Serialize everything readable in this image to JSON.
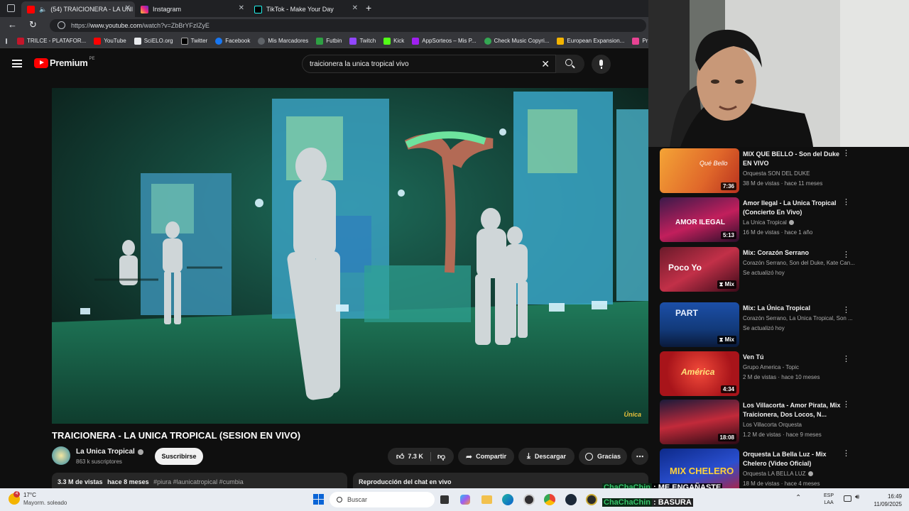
{
  "browser": {
    "tabs": [
      {
        "label": "(54) TRAICIONERA - LA UNI",
        "icon": "youtube-icon",
        "active": true
      },
      {
        "label": "Instagram",
        "icon": "instagram-icon",
        "active": false
      },
      {
        "label": "TikTok - Make Your Day",
        "icon": "tiktok-icon",
        "active": false
      }
    ],
    "url_prefix": "https://",
    "url_host": "www.youtube.com",
    "url_path": "/watch?v=ZbBrYFzIZyE",
    "bookmarks": [
      {
        "label": "TRILCE - PLATAFOR...",
        "color": "#c4162a"
      },
      {
        "label": "YouTube",
        "color": "#ff0000"
      },
      {
        "label": "SciELO.org",
        "color": "#e8eaed"
      },
      {
        "label": "Twitter",
        "color": "#e8eaed"
      },
      {
        "label": "Facebook",
        "color": "#1877f2"
      },
      {
        "label": "Mis Marcadores",
        "color": "#5f6368"
      },
      {
        "label": "Futbin",
        "color": "#2ea043"
      },
      {
        "label": "Twitch",
        "color": "#9146ff"
      },
      {
        "label": "Kick",
        "color": "#53fc18"
      },
      {
        "label": "AppSorteos – Mis P...",
        "color": "#a020f0"
      },
      {
        "label": "Check Music Copyri...",
        "color": "#34a853"
      },
      {
        "label": "European Expansion...",
        "color": "#f4b400"
      },
      {
        "label": "Pr",
        "color": "#e84393"
      }
    ]
  },
  "youtube": {
    "logo_text": "Premium",
    "region": "PE",
    "search_query": "traicionera la unica tropical vivo",
    "video_title": "TRAICIONERA - LA UNICA TROPICAL (SESION EN VIVO)",
    "channel_name": "La Unica Tropical",
    "subscribers": "863 k suscriptores",
    "subscribe_label": "Suscribirse",
    "likes": "7.3 K",
    "share_label": "Compartir",
    "download_label": "Descargar",
    "thanks_label": "Gracias",
    "views": "3.3 M de vistas",
    "uploaded": "hace 8 meses",
    "hashtags": "#piura #launicatropical #cumbia",
    "chat_replay_label": "Reproducción del chat en vivo",
    "watermark": "Única"
  },
  "recommendations": [
    {
      "title": "MIX QUE BELLO - Son del Duke EN VIVO",
      "channel": "Orquesta SON DEL DUKE",
      "meta": "38 M de vistas · hace 11 meses",
      "duration": "7:36",
      "verified": false,
      "mix": false,
      "thumb_text": "Qué Bello"
    },
    {
      "title": "Amor Ilegal - La Unica Tropical (Concierto En Vivo)",
      "channel": "La Unica Tropical",
      "meta": "16 M de vistas · hace 1 año",
      "duration": "5:13",
      "verified": true,
      "mix": false,
      "thumb_text": "AMOR ILEGAL"
    },
    {
      "title": "Mix: Corazón Serrano",
      "channel": "Corazón Serrano, Son del Duke, Kate Can...",
      "meta": "Se actualizó hoy",
      "duration": "Mix",
      "verified": false,
      "mix": true,
      "thumb_text": "Poco Yo"
    },
    {
      "title": "Mix: La Única Tropical",
      "channel": "Corazón Serrano, La Única Tropical, Son ...",
      "meta": "Se actualizó hoy",
      "duration": "Mix",
      "verified": false,
      "mix": true,
      "thumb_text": "PART"
    },
    {
      "title": "Ven Tú",
      "channel": "Grupo America - Topic",
      "meta": "2 M de vistas · hace 10 meses",
      "duration": "4:34",
      "verified": false,
      "mix": false,
      "thumb_text": "América"
    },
    {
      "title": "Los Villacorta - Amor Pirata, Mix Traicionera, Dos Locos, N...",
      "channel": "Los Villacorta Orquesta",
      "meta": "1.2 M de vistas · hace 9 meses",
      "duration": "18:08",
      "verified": false,
      "mix": false,
      "thumb_text": ""
    },
    {
      "title": "Orquesta La Bella Luz - Mix Chelero (Video Oficial)",
      "channel": "Orquesta LA BELLA LUZ",
      "meta": "18 M de vistas · hace 4 meses",
      "duration": "",
      "verified": true,
      "mix": false,
      "thumb_text": "MIX CHELERO"
    }
  ],
  "stream_chat": [
    {
      "user": "ChaChaChin",
      "message": ": ME ENGAÑASTE"
    },
    {
      "user": "ChaChaChin",
      "message": ": BASURA"
    }
  ],
  "taskbar": {
    "temperature": "17°C",
    "weather": "Mayorm. soleado",
    "weather_badge": "4",
    "search_placeholder": "Buscar",
    "language": "ESP",
    "layout": "LAA",
    "time": "16:49",
    "date": "11/09/2025"
  }
}
